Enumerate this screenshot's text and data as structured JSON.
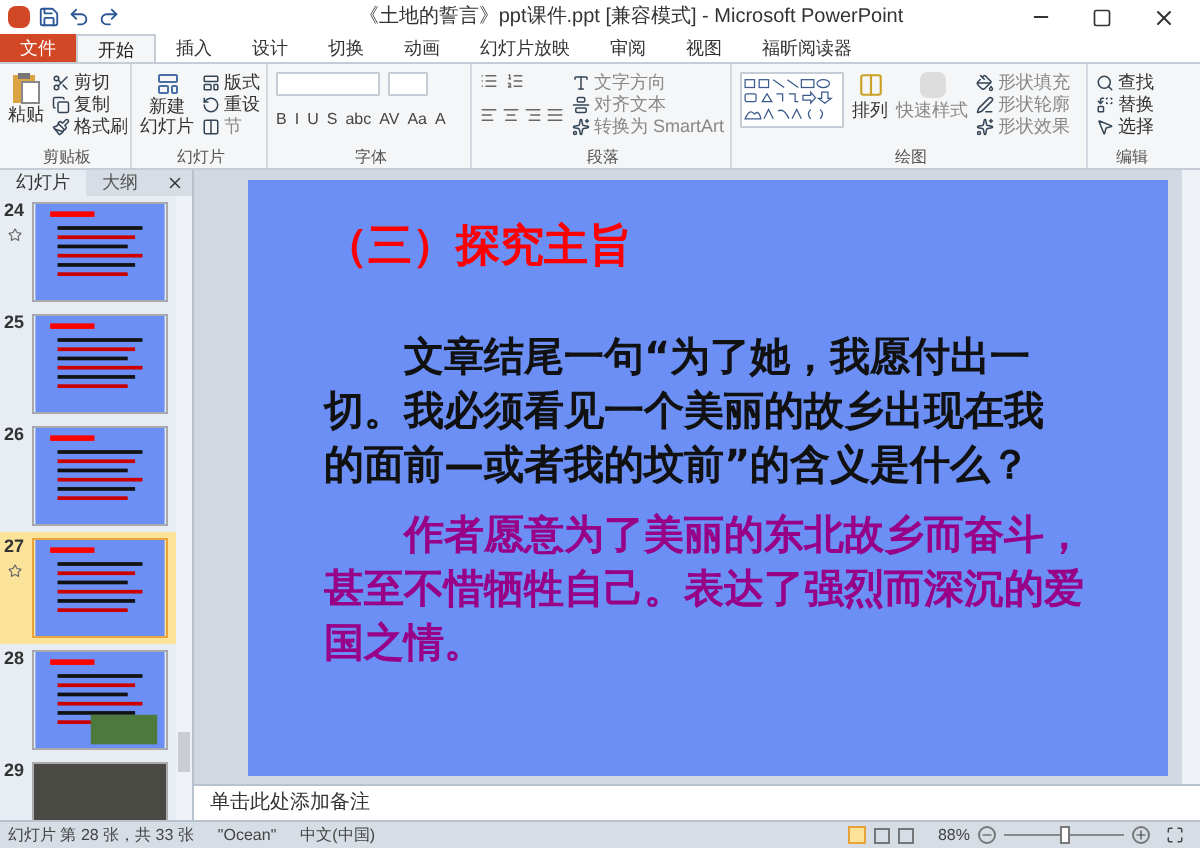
{
  "window": {
    "title": "《土地的誓言》ppt课件.ppt [兼容模式] - Microsoft PowerPoint"
  },
  "ribbon_tabs": [
    {
      "label": "文件",
      "kind": "file",
      "selected": false
    },
    {
      "label": "开始",
      "kind": "tab",
      "selected": true
    },
    {
      "label": "插入",
      "kind": "tab",
      "selected": false
    },
    {
      "label": "设计",
      "kind": "tab",
      "selected": false
    },
    {
      "label": "切换",
      "kind": "tab",
      "selected": false
    },
    {
      "label": "动画",
      "kind": "tab",
      "selected": false
    },
    {
      "label": "幻灯片放映",
      "kind": "tab",
      "selected": false
    },
    {
      "label": "审阅",
      "kind": "tab",
      "selected": false
    },
    {
      "label": "视图",
      "kind": "tab",
      "selected": false
    },
    {
      "label": "福昕阅读器",
      "kind": "tab",
      "selected": false
    }
  ],
  "clipboard": {
    "label": "剪贴板",
    "paste": "粘贴",
    "cut": "剪切",
    "copy": "复制",
    "format_painter": "格式刷"
  },
  "slides_group": {
    "label": "幻灯片",
    "new_slide": [
      "新建",
      "幻灯片"
    ],
    "layout": "版式",
    "reset": "重设",
    "section": "节"
  },
  "font_group": {
    "label": "字体",
    "buttons": [
      "B",
      "I",
      "U",
      "S",
      "abc",
      "AV",
      "Aa",
      "A"
    ]
  },
  "paragraph_group": {
    "label": "段落",
    "text_direction": "文字方向",
    "align_text": "对齐文本",
    "smartart": "转换为 SmartArt"
  },
  "drawing_group": {
    "label": "绘图",
    "arrange": "排列",
    "quick_styles": "快速样式",
    "fill": "形状填充",
    "outline": "形状轮廓",
    "effects": "形状效果"
  },
  "editing_group": {
    "label": "编辑",
    "find": "查找",
    "replace": "替换",
    "select": "选择"
  },
  "panel_tabs": [
    {
      "label": "幻灯片",
      "selected": true
    },
    {
      "label": "大纲",
      "selected": false
    }
  ],
  "thumbnails": [
    {
      "number": "24",
      "kind": "text",
      "animated": true,
      "selected": false
    },
    {
      "number": "25",
      "kind": "text",
      "animated": false,
      "selected": false
    },
    {
      "number": "26",
      "kind": "text",
      "animated": false,
      "selected": false
    },
    {
      "number": "27",
      "kind": "text",
      "animated": true,
      "selected": true
    },
    {
      "number": "28",
      "kind": "text_photo",
      "animated": false,
      "selected": false
    },
    {
      "number": "29",
      "kind": "photo",
      "animated": false,
      "selected": false
    }
  ],
  "slide": {
    "title": "（三）探究主旨",
    "question": "文章结尾一句“为了她，我愿付出一切。我必须看见一个美丽的故乡出现在我的面前—或者我的坟前”的含义是什么？",
    "answer": "作者愿意为了美丽的东北故乡而奋斗，甚至不惜牺牲自己。表达了强烈而深沉的爱国之情。"
  },
  "notes": {
    "placeholder": "单击此处添加备注"
  },
  "status_bar": {
    "slide_position": "幻灯片 第 28 张，共 33 张",
    "theme": "\"Ocean\"",
    "language": "中文(中国)",
    "zoom": "88%",
    "zoom_slider": {
      "level": 0.5
    }
  }
}
